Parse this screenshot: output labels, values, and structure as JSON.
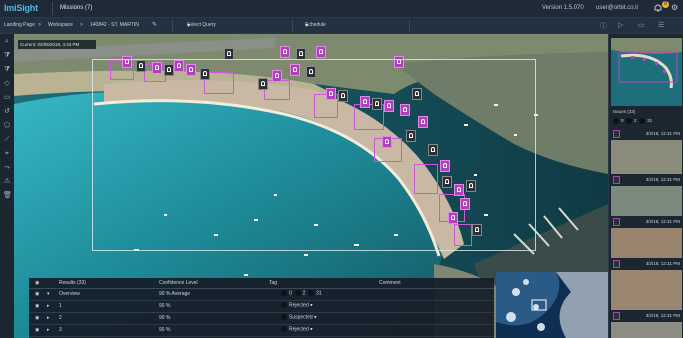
{
  "app": {
    "logo": "ImiSight",
    "mission": "Missions (7)",
    "version": "Version 1.5.070",
    "user": "user@orbit.co.il",
    "notifications": "8"
  },
  "breadcrumb": {
    "items": [
      "Landing Page",
      "Workspace",
      "140842 - ST. MARTIN"
    ],
    "separator": ">"
  },
  "query": {
    "label": "Select Query"
  },
  "schedule": {
    "label": "Schedule"
  },
  "map": {
    "current_label": "Current: 02/05/2018, 4:43 PM"
  },
  "results": {
    "headers": [
      "Results (33)",
      "Confidence Level",
      "Tag",
      "Comment"
    ],
    "overview": {
      "name": "Overview",
      "confidence": "90 % Average",
      "tag_counts": [
        "0",
        "2",
        "31"
      ]
    },
    "rows": [
      {
        "id": "1",
        "confidence": "90 %",
        "tag": "Rejected"
      },
      {
        "id": "2",
        "confidence": "90 %",
        "tag": "Suspected"
      },
      {
        "id": "3",
        "confidence": "90 %",
        "tag": "Rejected"
      }
    ]
  },
  "issues": {
    "title": "Issues (33)",
    "counts": [
      "0",
      "2",
      "31"
    ],
    "items": [
      {
        "time": "3/2/18, 12:31 PM"
      },
      {
        "time": "3/2/18, 12:31 PM"
      },
      {
        "time": "3/2/18, 12:31 PM"
      },
      {
        "time": "3/2/18, 12:31 PM"
      },
      {
        "time": "3/2/18, 12:31 PM"
      }
    ]
  },
  "colors": {
    "accent": "#4fb6e6",
    "detection": "#b33fbf",
    "topbar": "#1e2a36"
  }
}
